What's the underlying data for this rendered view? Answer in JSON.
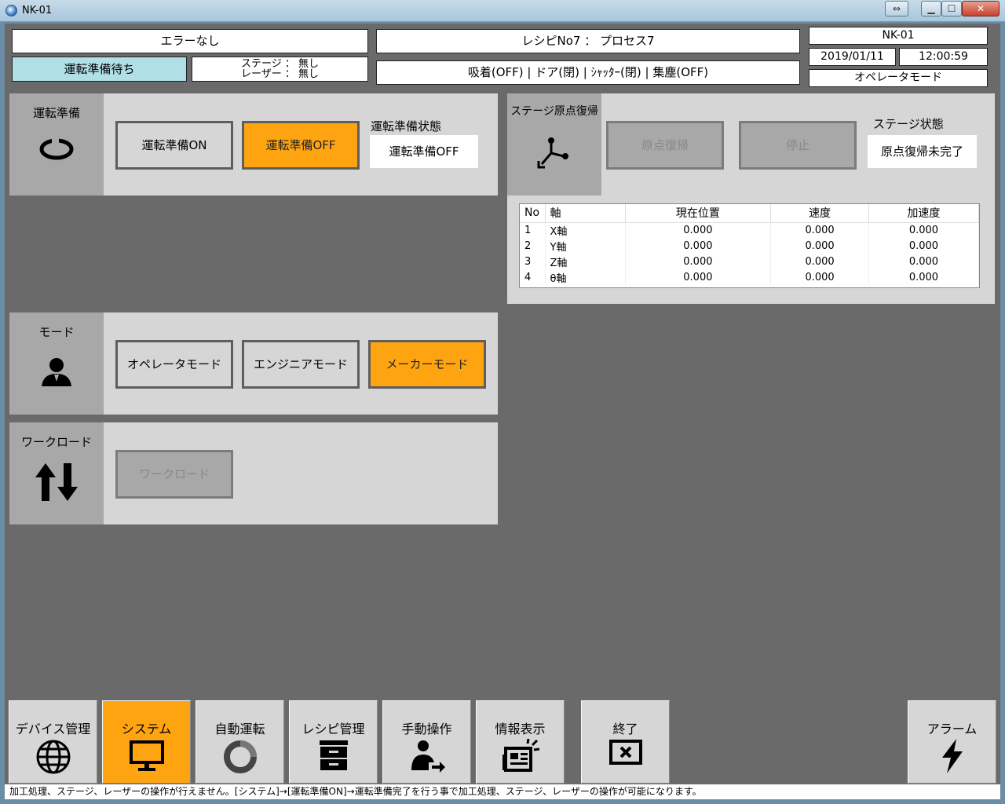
{
  "window": {
    "title": "NK-01"
  },
  "header": {
    "error": "エラーなし",
    "ready_state": "運転準備待ち",
    "stage_line1": "ステージ ： 無し",
    "stage_line2": "レーザー ： 無し",
    "recipe": "レシピNo7 ： プロセス7",
    "device_status": "吸着(OFF) | ドア(閉) | ｼｬｯﾀｰ(閉) | 集塵(OFF)",
    "device_name": "NK-01",
    "date": "2019/01/11",
    "time": "12:00:59",
    "mode": "オペレータモード"
  },
  "ready_panel": {
    "title": "運転準備",
    "on_label": "運転準備ON",
    "off_label": "運転準備OFF",
    "state_label": "運転準備状態",
    "state_value": "運転準備OFF"
  },
  "stage_panel": {
    "title": "ステージ原点復帰",
    "home_label": "原点復帰",
    "stop_label": "停止",
    "state_label": "ステージ状態",
    "state_value": "原点復帰未完了",
    "table": {
      "headers": [
        "No",
        "軸",
        "現在位置",
        "速度",
        "加速度"
      ],
      "rows": [
        [
          "1",
          "X軸",
          "0.000",
          "0.000",
          "0.000"
        ],
        [
          "2",
          "Y軸",
          "0.000",
          "0.000",
          "0.000"
        ],
        [
          "3",
          "Z軸",
          "0.000",
          "0.000",
          "0.000"
        ],
        [
          "4",
          "θ軸",
          "0.000",
          "0.000",
          "0.000"
        ]
      ]
    }
  },
  "mode_panel": {
    "title": "モード",
    "operator_label": "オペレータモード",
    "engineer_label": "エンジニアモード",
    "maker_label": "メーカーモード"
  },
  "workload_panel": {
    "title": "ワークロード",
    "button_label": "ワークロード"
  },
  "nav": {
    "device": "デバイス管理",
    "system": "システム",
    "auto": "自動運転",
    "recipe": "レシピ管理",
    "manual": "手動操作",
    "info": "情報表示",
    "exit": "終了",
    "alarm": "アラーム"
  },
  "status_message": "加工処理、ステージ、レーザーの操作が行えません。[システム]→[運転準備ON]→運転準備完了を行う事で加工処理、ステージ、レーザーの操作が可能になります。",
  "colors": {
    "accent": "#ffa411",
    "panel": "#d6d6d6",
    "ready_bg": "#b0dfe6"
  }
}
